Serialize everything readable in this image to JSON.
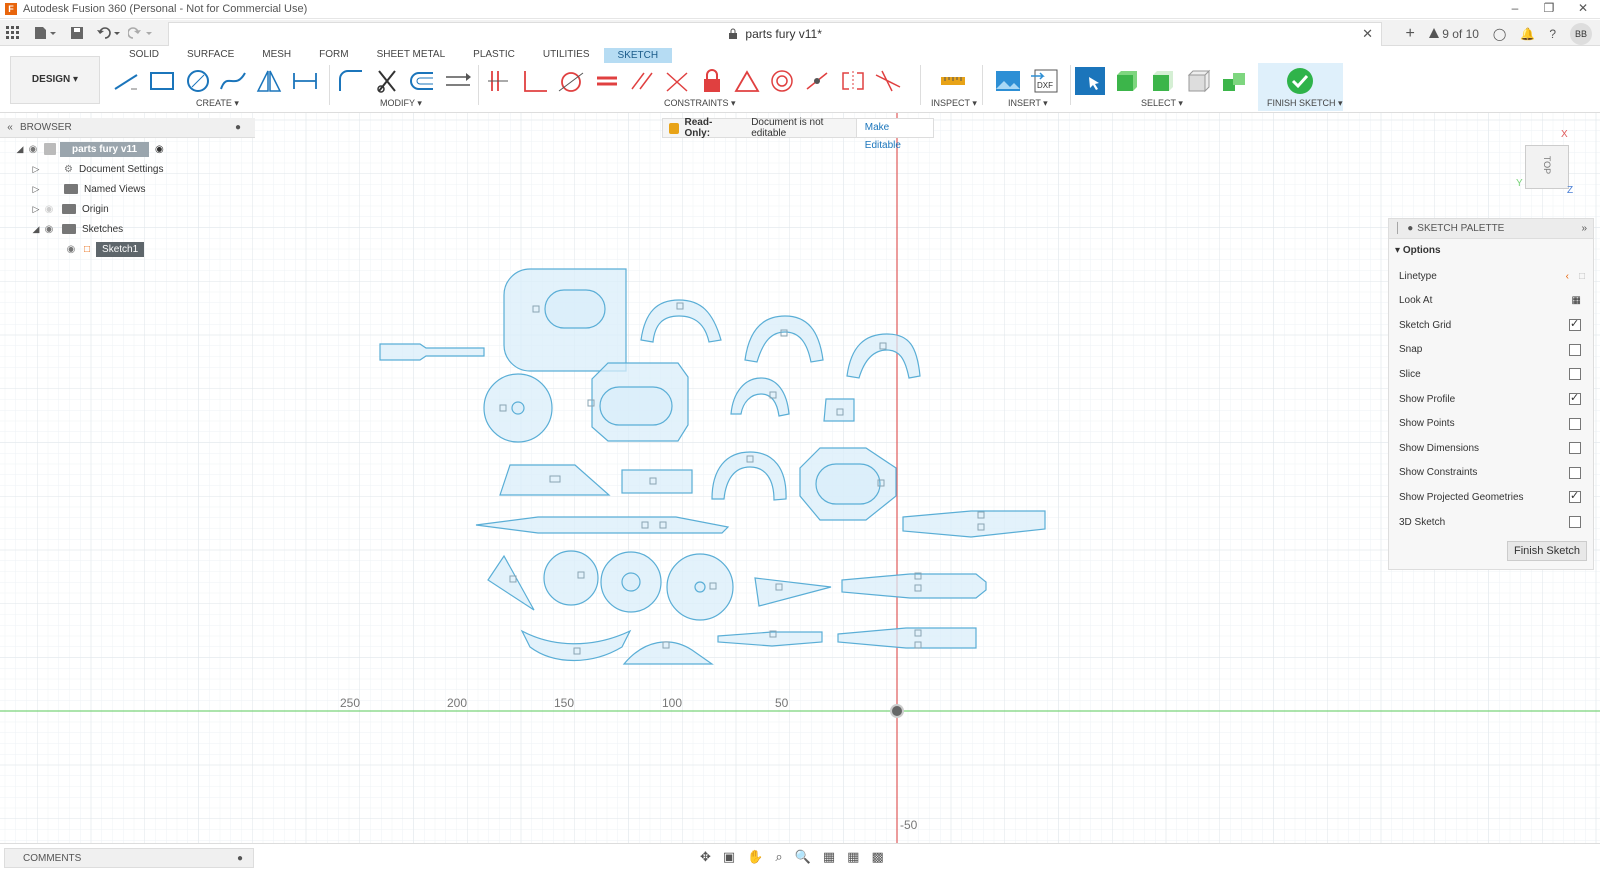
{
  "window": {
    "title": "Autodesk Fusion 360 (Personal - Not for Commercial Use)",
    "buttons": [
      "–",
      "❐",
      "✕"
    ]
  },
  "document": {
    "title": "parts fury v11*",
    "close": "✕",
    "page_count": "9 of 10",
    "user_initials": "BB"
  },
  "ribbon": {
    "workspace": "DESIGN ▾",
    "tabs": [
      "SOLID",
      "SURFACE",
      "MESH",
      "FORM",
      "SHEET METAL",
      "PLASTIC",
      "UTILITIES",
      "SKETCH"
    ],
    "active_tab": "SKETCH",
    "groups": {
      "create": "CREATE ▾",
      "modify": "MODIFY ▾",
      "constraints": "CONSTRAINTS ▾",
      "inspect": "INSPECT ▾",
      "insert": "INSERT ▾",
      "select": "SELECT ▾",
      "finish": "FINISH SKETCH ▾"
    },
    "accent": "#0696d7"
  },
  "browser": {
    "title": "BROWSER",
    "root": "parts fury v11",
    "items": [
      "Document Settings",
      "Named Views",
      "Origin",
      "Sketches"
    ],
    "sketch": "Sketch1"
  },
  "message": {
    "label": "Read-Only:",
    "text": "Document is not editable",
    "action": "Make Editable"
  },
  "axis": {
    "x_labels": [
      "250",
      "200",
      "150",
      "100",
      "50"
    ],
    "y_label": "-50",
    "x_color": "#e05a5a",
    "y_color": "#7ad37a"
  },
  "viewcube": {
    "face": "TOP",
    "x": "X",
    "y": "Y",
    "z": "Z"
  },
  "palette": {
    "title": "SKETCH PALETTE",
    "section": "Options",
    "options": [
      {
        "label": "Linetype",
        "type": "icons"
      },
      {
        "label": "Look At",
        "type": "icon"
      },
      {
        "label": "Sketch Grid",
        "type": "check",
        "checked": true
      },
      {
        "label": "Snap",
        "type": "check",
        "checked": false
      },
      {
        "label": "Slice",
        "type": "check",
        "checked": false
      },
      {
        "label": "Show Profile",
        "type": "check",
        "checked": true
      },
      {
        "label": "Show Points",
        "type": "check",
        "checked": false
      },
      {
        "label": "Show Dimensions",
        "type": "check",
        "checked": false
      },
      {
        "label": "Show Constraints",
        "type": "check",
        "checked": false
      },
      {
        "label": "Show Projected Geometries",
        "type": "check",
        "checked": true
      },
      {
        "label": "3D Sketch",
        "type": "check",
        "checked": false
      }
    ],
    "finish_button": "Finish Sketch"
  },
  "comments": {
    "title": "COMMENTS"
  },
  "colors": {
    "sketch_fill": "#d9eef9",
    "sketch_stroke": "#5aaed6",
    "grid": "#e8eef2"
  }
}
